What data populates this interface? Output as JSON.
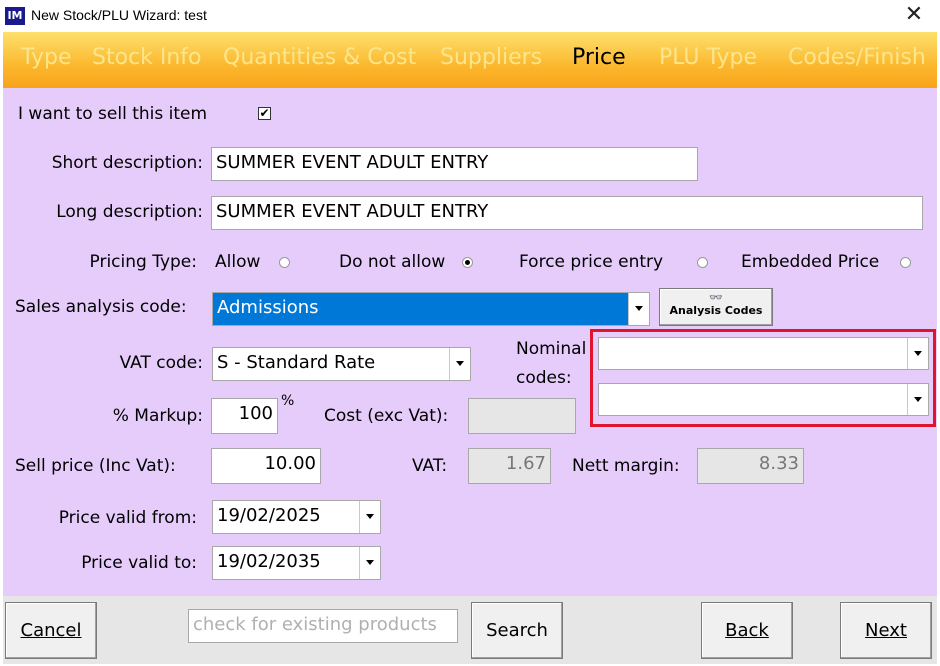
{
  "window": {
    "title": "New Stock/PLU Wizard: test",
    "icon_text": "IM",
    "close_glyph": "✕"
  },
  "tabs": [
    {
      "label": "Type",
      "active": false
    },
    {
      "label": "Stock Info",
      "active": false
    },
    {
      "label": "Quantities & Cost",
      "active": false
    },
    {
      "label": "Suppliers",
      "active": false
    },
    {
      "label": "Price",
      "active": true
    },
    {
      "label": "PLU Type",
      "active": false
    },
    {
      "label": "Codes/Finish",
      "active": false
    }
  ],
  "form": {
    "sell_item_label": "I want to sell this item",
    "sell_item_checked": true,
    "check_glyph": "✔",
    "short_desc_label": "Short description:",
    "short_desc_value": "SUMMER EVENT ADULT ENTRY",
    "long_desc_label": "Long description:",
    "long_desc_value": "SUMMER EVENT ADULT ENTRY",
    "pricing_type_label": "Pricing Type:",
    "pricing_options": [
      {
        "label": "Allow",
        "selected": false
      },
      {
        "label": "Do not allow",
        "selected": true
      },
      {
        "label": "Force price entry",
        "selected": false
      },
      {
        "label": "Embedded Price",
        "selected": false
      }
    ],
    "sales_analysis_label": "Sales analysis code:",
    "sales_analysis_value": "Admissions",
    "analysis_codes_button": "Analysis Codes",
    "analysis_codes_icon_glyph": "👓",
    "vat_code_label": "VAT code:",
    "vat_code_value": "S - Standard Rate",
    "nominal_label_1": "Nominal",
    "nominal_label_2": "codes:",
    "nominal_code_1": "",
    "nominal_code_2": "",
    "markup_label": "% Markup:",
    "markup_value": "100",
    "markup_unit": "%",
    "cost_label": "Cost (exc Vat):",
    "cost_value": "",
    "sell_price_label": "Sell price (Inc Vat):",
    "sell_price_value": "10.00",
    "vat_label": "VAT:",
    "vat_value": "1.67",
    "nett_margin_label": "Nett margin:",
    "nett_margin_value": "8.33",
    "valid_from_label": "Price valid from:",
    "valid_from_value": "19/02/2025",
    "valid_to_label": "Price valid to:",
    "valid_to_value": "19/02/2035"
  },
  "footer": {
    "cancel": "Cancel",
    "search_placeholder": "check for existing products",
    "search_button": "Search",
    "back": "Back",
    "next": "Next"
  },
  "colors": {
    "content_bg": "#e6ccfb",
    "tab_active": "#000000",
    "tab_inactive": "#fde58c",
    "highlight": "#e0142c",
    "selection": "#0078d7"
  }
}
